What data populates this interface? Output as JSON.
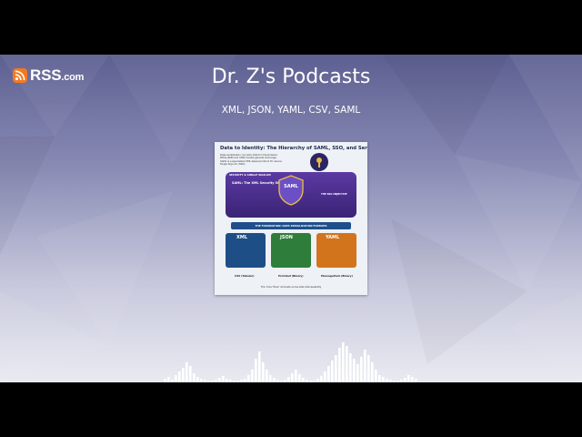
{
  "brand": {
    "name": "RSS",
    "domain": ".com",
    "accent": "#f47a20"
  },
  "header": {
    "title": "Dr. Z's Podcasts",
    "subtitle": "XML, JSON, YAML, CSV, SAML"
  },
  "cover": {
    "title": "Data to Identity: The Hierarchy of SAML, SSO, and Serialization",
    "intro": "Data serialization converts data for transmission. While JSON and YAML handle general exchange, SAML is a specialized XML-based protocol for secure Single Sign-On (SSO).",
    "security_label": "SECURITY & SINGLE SIGN-ON",
    "saml_standard": "SAML: The XML Security Standard",
    "shield_label": "SAML",
    "sso_objective": "THE SSO OBJECTIVE",
    "foundation": "THE FOUNDATION: DATA SERIALIZATION FORMATS",
    "formats": [
      "XML",
      "JSON",
      "YAML"
    ],
    "footer_labels": [
      "CSV (Tabular)",
      "Protobuf (Binary)",
      "MessagePack (Binary)"
    ],
    "footer_note": "The \"Core Three\" dominate across data interoperability"
  },
  "colors": {
    "panel_top": "#5d5f91",
    "panel_bottom": "#e9eaf1",
    "saml_purple": "#4a2e8c",
    "xml_blue": "#1d4f86",
    "json_green": "#2f7d3a",
    "yaml_orange": "#d2741b"
  }
}
